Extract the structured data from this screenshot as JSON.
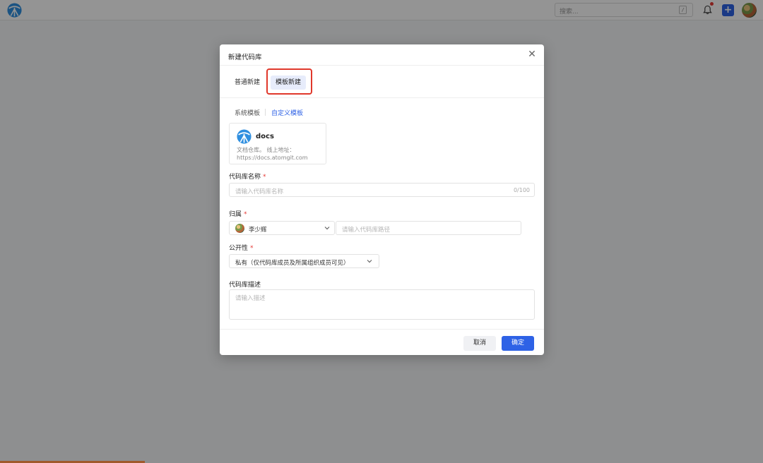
{
  "topbar": {
    "search_placeholder": "搜索...",
    "search_shortcut": "/",
    "create_label": "+"
  },
  "dialog": {
    "title": "新建代码库",
    "close_glyph": "✕",
    "tabs": [
      "普通新建",
      "模板新建"
    ],
    "active_tab": "模板新建",
    "template_tabs": [
      "系统模板",
      "自定义模板"
    ],
    "active_template_tab": "自定义模板",
    "template_card": {
      "name": "docs",
      "desc_line1": "文档仓库。 线上地址：",
      "desc_line2": "https://docs.atomgit.com"
    },
    "repo_name": {
      "label": "代码库名称",
      "required": "*",
      "placeholder": "请输入代码库名称",
      "counter": "0/100"
    },
    "owner": {
      "label": "归属",
      "required": "*",
      "selected_user": "李少辉",
      "path_placeholder": "请输入代码库路径"
    },
    "visibility": {
      "label": "公开性",
      "required": "*",
      "selected": "私有（仅代码库成员及所属组织成员可见）"
    },
    "description": {
      "label": "代码库描述",
      "placeholder": "请输入描述"
    },
    "buttons": {
      "cancel": "取消",
      "confirm": "确定"
    }
  },
  "colors": {
    "primary": "#2e62e6",
    "highlight": "#e0382b",
    "required": "#e53935",
    "overlay": "rgba(0,0,0,0.42)"
  },
  "icons": [
    "app-logo-icon",
    "bell-icon",
    "plus-icon",
    "close-icon",
    "chevron-down-icon",
    "docs-logo-icon"
  ]
}
